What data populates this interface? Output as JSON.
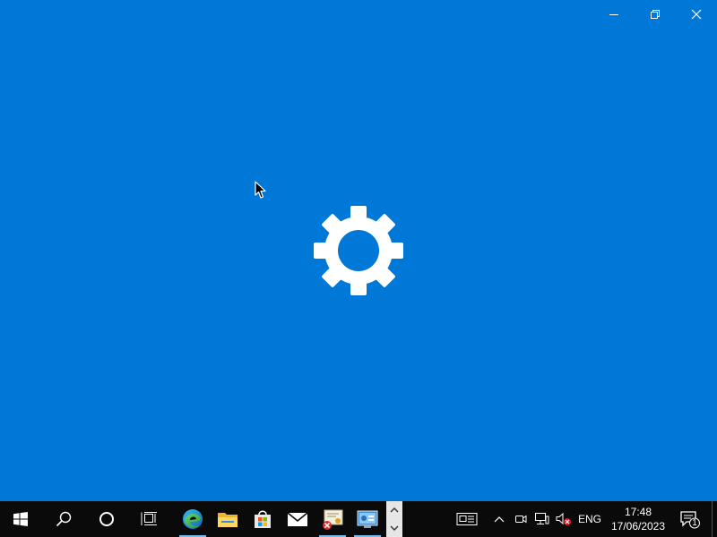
{
  "window": {
    "controls": {
      "minimize_icon": "minimize-icon",
      "restore_icon": "restore-icon",
      "close_icon": "close-icon"
    },
    "splash_icon": "settings-gear-icon",
    "background_color": "#0078d7"
  },
  "taskbar": {
    "background_color": "#0a0a0a",
    "start_icon": "windows-logo-icon",
    "search_icon": "search-icon",
    "cortana_icon": "cortana-circle-icon",
    "task_view_icon": "task-view-icon",
    "pinned_apps": [
      {
        "name": "Microsoft Edge",
        "icon": "edge-icon",
        "active": true
      },
      {
        "name": "File Explorer",
        "icon": "folder-icon",
        "active": false
      },
      {
        "name": "Microsoft Store",
        "icon": "store-bag-icon",
        "active": false
      },
      {
        "name": "Mail",
        "icon": "mail-icon",
        "active": false
      },
      {
        "name": "Certificate",
        "icon": "certificate-error-icon",
        "active": true
      },
      {
        "name": "Control Panel",
        "icon": "control-panel-icon",
        "active": true
      }
    ],
    "tray": {
      "news_icon": "news-widget-icon",
      "chevron_icon": "show-hidden-icons-chevron",
      "meet_icon": "meet-now-icon",
      "network_icon": "network-icon",
      "volume_icon": "volume-muted-icon",
      "language": "ENG",
      "time": "17:48",
      "date": "17/06/2023",
      "notification_count": "1"
    }
  }
}
